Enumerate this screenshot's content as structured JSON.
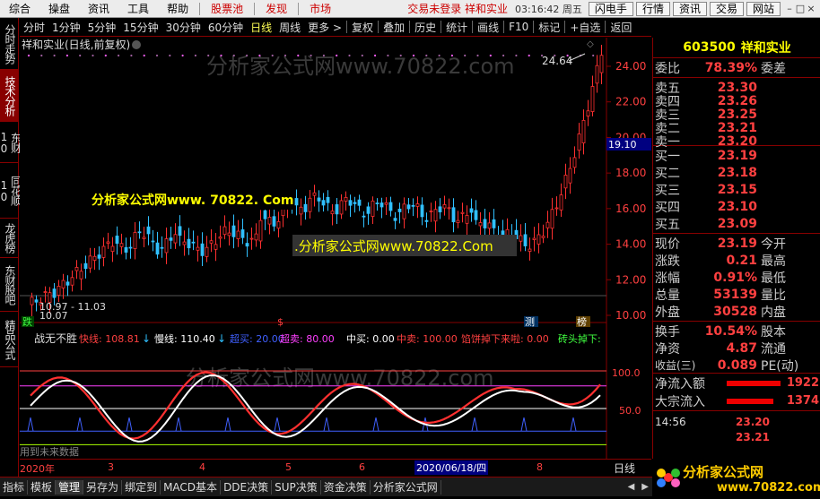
{
  "menu": {
    "items": [
      "综合",
      "操盘",
      "资讯",
      "工具",
      "帮助"
    ],
    "hot_items": [
      "股票池",
      "发现",
      "市场"
    ],
    "status": "交易未登录  祥和实业",
    "clock": "03:16:42 周五",
    "right_buttons": [
      "闪电手",
      "行情",
      "资讯",
      "交易",
      "网站"
    ],
    "win_controls": [
      "–",
      "□",
      "×"
    ]
  },
  "toolbar": {
    "periods": [
      "分时",
      "1分钟",
      "5分钟",
      "15分钟",
      "30分钟",
      "60分钟",
      "日线",
      "周线",
      "更多 >"
    ],
    "active_period": "日线",
    "actions": [
      "复权",
      "叠加",
      "历史",
      "统计",
      "画线",
      "F10",
      "标记",
      "+自选",
      "返回"
    ]
  },
  "left_tabs": [
    {
      "label": "分时走势",
      "active": false
    },
    {
      "label": "技术分析",
      "active": true
    },
    {
      "label": "东财10",
      "active": false
    },
    {
      "label": "同花顺10",
      "active": false
    },
    {
      "label": "龙虎榜",
      "active": false
    },
    {
      "label": "东财股吧",
      "active": false
    },
    {
      "label": "精品公式",
      "active": false
    }
  ],
  "chart": {
    "header": "祥和实业(日线,前复权)",
    "watermark_top": "分析家公式网www.70822.com",
    "watermark_mid": "分析家公式网www.70822.com",
    "overlay1": "分析家公式网www. 70822. Com",
    "overlay2": ".分析家公式网www.70822.Com",
    "high_label": "24.64",
    "low_label1": "10.97 - 11.03",
    "low_label2": "10.07",
    "price_axis": [
      "24.00",
      "22.00",
      "20.00",
      "18.00",
      "16.00",
      "14.00",
      "12.00",
      "10.00"
    ],
    "current_price_tag": "19.10",
    "markers": {
      "m1": "跌",
      "m2": "$",
      "m3": "测",
      "m4": "榜"
    },
    "indicator_name": "战无不胜",
    "ind_labels": [
      {
        "t": "快线: 108.81",
        "c": "#ff4040"
      },
      {
        "t": "慢线: 110.40",
        "c": "#ffffff"
      },
      {
        "t": "超买: 20.00",
        "c": "#4060ff"
      },
      {
        "t": "超卖: 80.00",
        "c": "#ff40ff"
      },
      {
        "t": "中买: 0.00",
        "c": "#ffffff"
      },
      {
        "t": "中卖: 100.00",
        "c": "#ff4040"
      },
      {
        "t": "馅饼掉下来啦: 0.00",
        "c": "#ff4040"
      },
      {
        "t": "砖头掉下:",
        "c": "#40ff40"
      }
    ],
    "ind_arrows": {
      "fast": "↓",
      "slow": "↓"
    },
    "ind_axis": [
      "100.0",
      "50.0"
    ],
    "ind_note": "用到未来数据",
    "date_axis": [
      "2020年",
      "3",
      "4",
      "5",
      "6",
      "2020/06/18/四",
      "8"
    ],
    "period_tag": "日线"
  },
  "quote": {
    "code": "603500",
    "name": "祥和实业",
    "webi_label": "委比",
    "webi_value": "78.39%",
    "webi_right": "委差",
    "asks": [
      {
        "label": "卖五",
        "price": "23.30"
      },
      {
        "label": "卖四",
        "price": "23.26"
      },
      {
        "label": "卖三",
        "price": "23.25"
      },
      {
        "label": "卖二",
        "price": "23.21"
      },
      {
        "label": "卖一",
        "price": "23.20"
      }
    ],
    "bids": [
      {
        "label": "买一",
        "price": "23.19"
      },
      {
        "label": "买二",
        "price": "23.18"
      },
      {
        "label": "买三",
        "price": "23.15"
      },
      {
        "label": "买四",
        "price": "23.10"
      },
      {
        "label": "买五",
        "price": "23.09"
      }
    ],
    "stats": [
      {
        "label": "现价",
        "value": "23.19",
        "right": "今开"
      },
      {
        "label": "涨跌",
        "value": "0.21",
        "right": "最高"
      },
      {
        "label": "涨幅",
        "value": "0.91%",
        "right": "最低"
      },
      {
        "label": "总量",
        "value": "53139",
        "right": "量比"
      },
      {
        "label": "外盘",
        "value": "30528",
        "right": "内盘"
      }
    ],
    "stats2": [
      {
        "label": "换手",
        "value": "10.54%",
        "right": "股本"
      },
      {
        "label": "净资",
        "value": "4.87",
        "right": "流通"
      },
      {
        "label": "收益(三)",
        "value": "0.089",
        "right": "PE(动)"
      }
    ],
    "flow": [
      {
        "label": "净流入额",
        "value": "1922"
      },
      {
        "label": "大宗流入",
        "value": "1374"
      }
    ],
    "tick_time": "14:56",
    "tick_p1": "23.20",
    "tick_p2": "23.21"
  },
  "bottom_tabs": [
    "指标",
    "模板",
    "管理",
    "另存为",
    "绑定到",
    "MACD基本",
    "DDE决策",
    "SUP决策",
    "资金决策",
    "分析家公式网"
  ],
  "bottom_active": "管理",
  "logo": {
    "title": "分析家公式网",
    "url": "www.70822.com"
  },
  "colors": {
    "up": "#ff3030",
    "down": "#30c0ff",
    "accent": "#ffff00",
    "border": "#880000"
  }
}
